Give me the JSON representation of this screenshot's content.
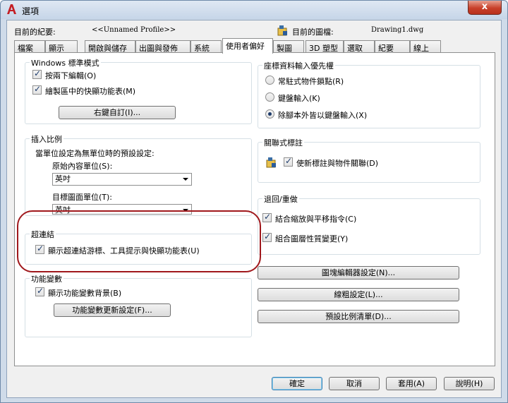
{
  "window": {
    "title": "選項",
    "close_glyph": "x"
  },
  "profile": {
    "label": "目前的紀要:",
    "value": "<<Unnamed Profile>>"
  },
  "drawing": {
    "label": "目前的圖檔:",
    "value": "Drawing1.dwg"
  },
  "tabs": [
    "檔案",
    "顯示",
    "開啟與儲存",
    "出圖與發佈",
    "系統",
    "使用者偏好",
    "製圖",
    "3D 塑型",
    "選取",
    "紀要",
    "線上"
  ],
  "windows_std": {
    "title": "Windows 標準模式",
    "dbl_click_edit": "按兩下編輯(O)",
    "shortcut_menu": "繪製區中的快顯功能表(M)",
    "right_click_btn": "右鍵自訂(I)..."
  },
  "insert_scale": {
    "title": "插入比例",
    "desc": "當單位設定為無單位時的預設設定:",
    "source_label": "原始內容單位(S):",
    "source_value": "英吋",
    "target_label": "目標圖面單位(T):",
    "target_value": "英吋"
  },
  "hyperlink": {
    "title": "超連結",
    "option": "顯示超連結游標、工具提示與快顯功能表(U)"
  },
  "fields": {
    "title": "功能變數",
    "background": "顯示功能變數背景(B)",
    "update_btn": "功能變數更新設定(F)..."
  },
  "coord_priority": {
    "title": "座標資料輸入優先權",
    "opt1": "常駐式物件鎖點(R)",
    "opt2": "鍵盤輸入(K)",
    "opt3": "除腳本外皆以鍵盤輸入(X)"
  },
  "assoc_dim": {
    "title": "關聯式標註",
    "option": "使新標註與物件關聯(D)"
  },
  "undo_redo": {
    "title": "退回/重做",
    "zoom_pan": "結合縮放與平移指令(C)",
    "layer_prop": "組合圖層性質變更(Y)"
  },
  "right_buttons": {
    "block_editor": "圖塊編輯器設定(N)...",
    "lineweight": "線粗設定(L)...",
    "scale_list": "預設比例清單(D)..."
  },
  "footer": {
    "ok": "確定",
    "cancel": "取消",
    "apply": "套用(A)",
    "help": "說明(H)"
  },
  "colors": {
    "accent": "#1d3b6b",
    "annotation": "#a0181c",
    "titlebar": "#cfdbe9"
  }
}
